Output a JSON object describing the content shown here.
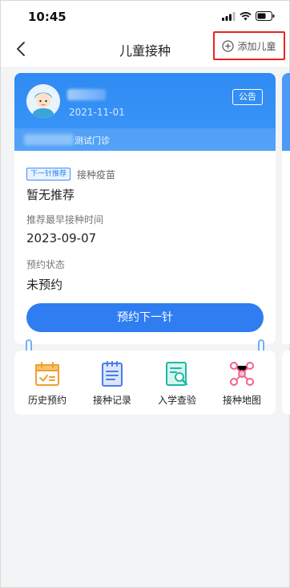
{
  "status_bar": {
    "time": "10:45"
  },
  "nav": {
    "title": "儿童接种",
    "add_child_label": "添加儿童"
  },
  "child": {
    "dob": "2021-11-01",
    "notice_label": "公告",
    "clinic_suffix": "测试门诊"
  },
  "vaccine": {
    "next_tag": "下一针推荐",
    "vaccine_label": "接种疫苗",
    "vaccine_value": "暂无推荐",
    "time_label": "推荐最早接种时间",
    "time_value": "2023-09-07",
    "status_label": "预约状态",
    "status_value": "未预约",
    "book_button": "预约下一针"
  },
  "shortcuts": [
    {
      "label": "历史预约",
      "icon": "calendar-check-icon",
      "color": "#f0a030"
    },
    {
      "label": "接种记录",
      "icon": "clipboard-list-icon",
      "color": "#4a7de8"
    },
    {
      "label": "入学查验",
      "icon": "document-search-icon",
      "color": "#1fb8a6"
    },
    {
      "label": "接种地图",
      "icon": "network-map-icon",
      "color": "#f0648a"
    }
  ],
  "colors": {
    "primary": "#2f7df1",
    "highlight_border": "#e8251c"
  }
}
